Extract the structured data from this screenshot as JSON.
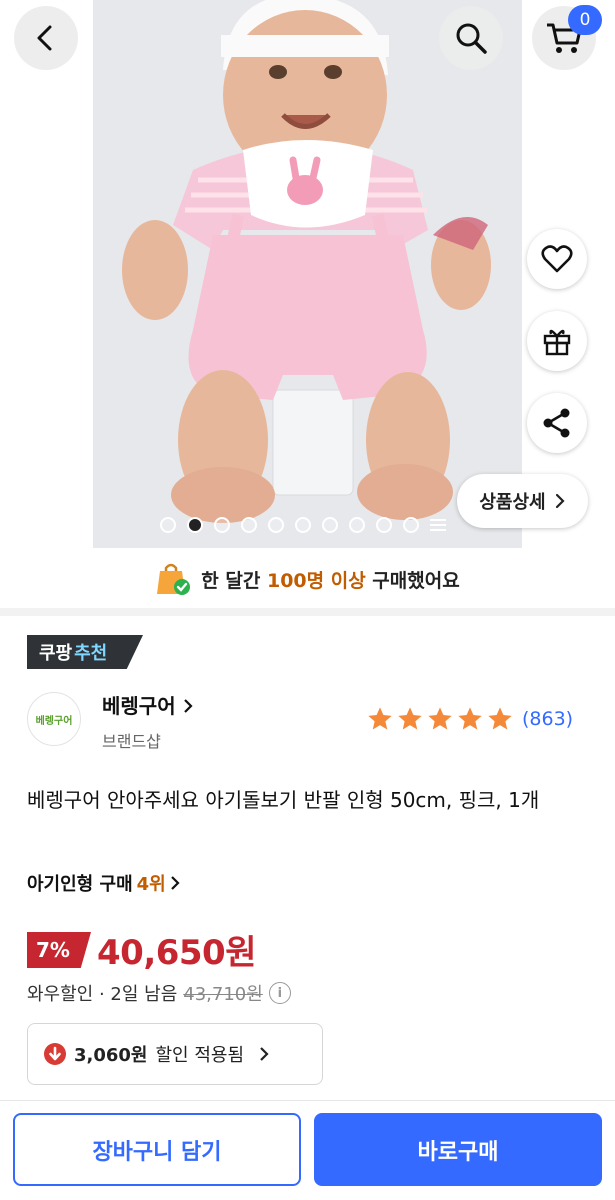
{
  "header": {
    "cart_count": "0"
  },
  "hero": {
    "detail_button_label": "상품상세",
    "slide_count": 10,
    "active_slide": 2
  },
  "social_proof": {
    "prefix": "한 달간 ",
    "highlight": "100명 이상",
    "suffix": " 구매했어요"
  },
  "recommendation_badge": {
    "main": "쿠팡",
    "accent": "추천"
  },
  "brand": {
    "logo_text": "베렝구어",
    "name": "베렝구어",
    "shop_label": "브랜드샵"
  },
  "rating": {
    "stars": 5,
    "review_count": "(863)"
  },
  "product": {
    "title": "베렝구어 안아주세요 아기돌보기 반팔 인형 50cm, 핑크, 1개",
    "rank_prefix": "아기인형 구매 ",
    "rank_number": "4위"
  },
  "pricing": {
    "discount": "7%",
    "price": "40,650원",
    "deal_text": "와우할인 · 2일 남음",
    "original_price": "43,710원"
  },
  "coupon": {
    "amount": "3,060원",
    "label": "할인 적용됨"
  },
  "actions": {
    "add_to_cart": "장바구니 담기",
    "buy_now": "바로구매"
  },
  "colors": {
    "accent_blue": "#346aff",
    "price_red": "#c6262f",
    "highlight_orange": "#c15c00",
    "star_orange": "#f5893a"
  },
  "icons": [
    "back-icon",
    "search-icon",
    "cart-icon",
    "heart-icon",
    "gift-icon",
    "share-icon",
    "chevron-right-icon",
    "shopping-bag-icon",
    "star-icon",
    "info-icon",
    "down-arrow-icon"
  ]
}
